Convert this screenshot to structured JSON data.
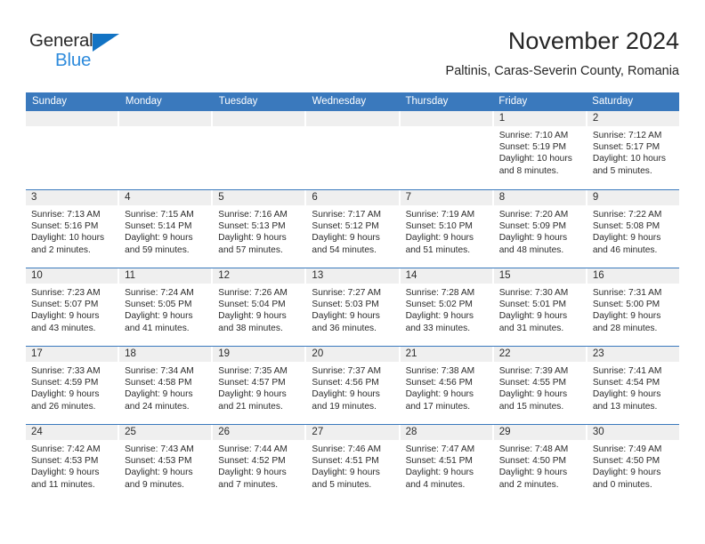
{
  "brand": {
    "name_top": "General",
    "name_bottom": "Blue",
    "accent_color": "#2e8bdc",
    "triangle_color": "#1273c4"
  },
  "header": {
    "title": "November 2024",
    "subtitle": "Paltinis, Caras-Severin County, Romania"
  },
  "theme": {
    "header_blue": "#3a79bd",
    "daynum_band": "#efefef",
    "text": "#2b2b2b"
  },
  "calendar": {
    "weekday_headers": [
      "Sunday",
      "Monday",
      "Tuesday",
      "Wednesday",
      "Thursday",
      "Friday",
      "Saturday"
    ],
    "weeks": [
      [
        {
          "day": "",
          "sunrise": "",
          "sunset": "",
          "daylight_1": "",
          "daylight_2": ""
        },
        {
          "day": "",
          "sunrise": "",
          "sunset": "",
          "daylight_1": "",
          "daylight_2": ""
        },
        {
          "day": "",
          "sunrise": "",
          "sunset": "",
          "daylight_1": "",
          "daylight_2": ""
        },
        {
          "day": "",
          "sunrise": "",
          "sunset": "",
          "daylight_1": "",
          "daylight_2": ""
        },
        {
          "day": "",
          "sunrise": "",
          "sunset": "",
          "daylight_1": "",
          "daylight_2": ""
        },
        {
          "day": "1",
          "sunrise": "Sunrise: 7:10 AM",
          "sunset": "Sunset: 5:19 PM",
          "daylight_1": "Daylight: 10 hours",
          "daylight_2": "and 8 minutes."
        },
        {
          "day": "2",
          "sunrise": "Sunrise: 7:12 AM",
          "sunset": "Sunset: 5:17 PM",
          "daylight_1": "Daylight: 10 hours",
          "daylight_2": "and 5 minutes."
        }
      ],
      [
        {
          "day": "3",
          "sunrise": "Sunrise: 7:13 AM",
          "sunset": "Sunset: 5:16 PM",
          "daylight_1": "Daylight: 10 hours",
          "daylight_2": "and 2 minutes."
        },
        {
          "day": "4",
          "sunrise": "Sunrise: 7:15 AM",
          "sunset": "Sunset: 5:14 PM",
          "daylight_1": "Daylight: 9 hours",
          "daylight_2": "and 59 minutes."
        },
        {
          "day": "5",
          "sunrise": "Sunrise: 7:16 AM",
          "sunset": "Sunset: 5:13 PM",
          "daylight_1": "Daylight: 9 hours",
          "daylight_2": "and 57 minutes."
        },
        {
          "day": "6",
          "sunrise": "Sunrise: 7:17 AM",
          "sunset": "Sunset: 5:12 PM",
          "daylight_1": "Daylight: 9 hours",
          "daylight_2": "and 54 minutes."
        },
        {
          "day": "7",
          "sunrise": "Sunrise: 7:19 AM",
          "sunset": "Sunset: 5:10 PM",
          "daylight_1": "Daylight: 9 hours",
          "daylight_2": "and 51 minutes."
        },
        {
          "day": "8",
          "sunrise": "Sunrise: 7:20 AM",
          "sunset": "Sunset: 5:09 PM",
          "daylight_1": "Daylight: 9 hours",
          "daylight_2": "and 48 minutes."
        },
        {
          "day": "9",
          "sunrise": "Sunrise: 7:22 AM",
          "sunset": "Sunset: 5:08 PM",
          "daylight_1": "Daylight: 9 hours",
          "daylight_2": "and 46 minutes."
        }
      ],
      [
        {
          "day": "10",
          "sunrise": "Sunrise: 7:23 AM",
          "sunset": "Sunset: 5:07 PM",
          "daylight_1": "Daylight: 9 hours",
          "daylight_2": "and 43 minutes."
        },
        {
          "day": "11",
          "sunrise": "Sunrise: 7:24 AM",
          "sunset": "Sunset: 5:05 PM",
          "daylight_1": "Daylight: 9 hours",
          "daylight_2": "and 41 minutes."
        },
        {
          "day": "12",
          "sunrise": "Sunrise: 7:26 AM",
          "sunset": "Sunset: 5:04 PM",
          "daylight_1": "Daylight: 9 hours",
          "daylight_2": "and 38 minutes."
        },
        {
          "day": "13",
          "sunrise": "Sunrise: 7:27 AM",
          "sunset": "Sunset: 5:03 PM",
          "daylight_1": "Daylight: 9 hours",
          "daylight_2": "and 36 minutes."
        },
        {
          "day": "14",
          "sunrise": "Sunrise: 7:28 AM",
          "sunset": "Sunset: 5:02 PM",
          "daylight_1": "Daylight: 9 hours",
          "daylight_2": "and 33 minutes."
        },
        {
          "day": "15",
          "sunrise": "Sunrise: 7:30 AM",
          "sunset": "Sunset: 5:01 PM",
          "daylight_1": "Daylight: 9 hours",
          "daylight_2": "and 31 minutes."
        },
        {
          "day": "16",
          "sunrise": "Sunrise: 7:31 AM",
          "sunset": "Sunset: 5:00 PM",
          "daylight_1": "Daylight: 9 hours",
          "daylight_2": "and 28 minutes."
        }
      ],
      [
        {
          "day": "17",
          "sunrise": "Sunrise: 7:33 AM",
          "sunset": "Sunset: 4:59 PM",
          "daylight_1": "Daylight: 9 hours",
          "daylight_2": "and 26 minutes."
        },
        {
          "day": "18",
          "sunrise": "Sunrise: 7:34 AM",
          "sunset": "Sunset: 4:58 PM",
          "daylight_1": "Daylight: 9 hours",
          "daylight_2": "and 24 minutes."
        },
        {
          "day": "19",
          "sunrise": "Sunrise: 7:35 AM",
          "sunset": "Sunset: 4:57 PM",
          "daylight_1": "Daylight: 9 hours",
          "daylight_2": "and 21 minutes."
        },
        {
          "day": "20",
          "sunrise": "Sunrise: 7:37 AM",
          "sunset": "Sunset: 4:56 PM",
          "daylight_1": "Daylight: 9 hours",
          "daylight_2": "and 19 minutes."
        },
        {
          "day": "21",
          "sunrise": "Sunrise: 7:38 AM",
          "sunset": "Sunset: 4:56 PM",
          "daylight_1": "Daylight: 9 hours",
          "daylight_2": "and 17 minutes."
        },
        {
          "day": "22",
          "sunrise": "Sunrise: 7:39 AM",
          "sunset": "Sunset: 4:55 PM",
          "daylight_1": "Daylight: 9 hours",
          "daylight_2": "and 15 minutes."
        },
        {
          "day": "23",
          "sunrise": "Sunrise: 7:41 AM",
          "sunset": "Sunset: 4:54 PM",
          "daylight_1": "Daylight: 9 hours",
          "daylight_2": "and 13 minutes."
        }
      ],
      [
        {
          "day": "24",
          "sunrise": "Sunrise: 7:42 AM",
          "sunset": "Sunset: 4:53 PM",
          "daylight_1": "Daylight: 9 hours",
          "daylight_2": "and 11 minutes."
        },
        {
          "day": "25",
          "sunrise": "Sunrise: 7:43 AM",
          "sunset": "Sunset: 4:53 PM",
          "daylight_1": "Daylight: 9 hours",
          "daylight_2": "and 9 minutes."
        },
        {
          "day": "26",
          "sunrise": "Sunrise: 7:44 AM",
          "sunset": "Sunset: 4:52 PM",
          "daylight_1": "Daylight: 9 hours",
          "daylight_2": "and 7 minutes."
        },
        {
          "day": "27",
          "sunrise": "Sunrise: 7:46 AM",
          "sunset": "Sunset: 4:51 PM",
          "daylight_1": "Daylight: 9 hours",
          "daylight_2": "and 5 minutes."
        },
        {
          "day": "28",
          "sunrise": "Sunrise: 7:47 AM",
          "sunset": "Sunset: 4:51 PM",
          "daylight_1": "Daylight: 9 hours",
          "daylight_2": "and 4 minutes."
        },
        {
          "day": "29",
          "sunrise": "Sunrise: 7:48 AM",
          "sunset": "Sunset: 4:50 PM",
          "daylight_1": "Daylight: 9 hours",
          "daylight_2": "and 2 minutes."
        },
        {
          "day": "30",
          "sunrise": "Sunrise: 7:49 AM",
          "sunset": "Sunset: 4:50 PM",
          "daylight_1": "Daylight: 9 hours",
          "daylight_2": "and 0 minutes."
        }
      ]
    ]
  }
}
